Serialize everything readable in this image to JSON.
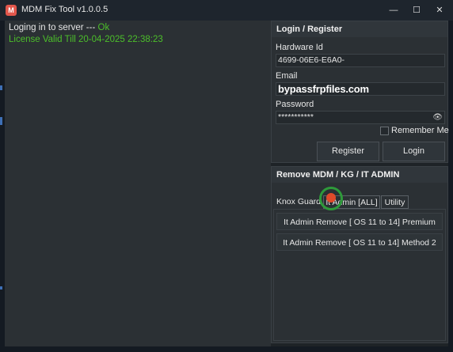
{
  "window": {
    "title": "MDM Fix Tool v1.0.0.5",
    "app_icon_letter": "M",
    "controls": {
      "minimize": "—",
      "maximize": "☐",
      "close": "✕"
    }
  },
  "log": {
    "line1_text": "Loging in to server --- ",
    "line1_status": "Ok",
    "line2": "License Valid Till 20-04-2025 22:38:23"
  },
  "login_panel": {
    "title": "Login / Register",
    "hardware_label": "Hardware Id",
    "hardware_value": "4699-06E6-E6A0-",
    "email_label": "Email",
    "email_value": "bypassfrpfiles.com",
    "password_label": "Password",
    "password_value": "***********",
    "eye_icon": "👁",
    "remember_label": "Remember Me",
    "register_label": "Register",
    "login_label": "Login"
  },
  "remove_panel": {
    "title": "Remove MDM / KG / IT ADMIN",
    "tabs": [
      "Knox Guard",
      "It Admin [ALL]",
      "Utility"
    ],
    "actions": [
      "It Admin Remove [ OS 11 to 14] Premium",
      "It Admin Remove [ OS 11 to 14] Method 2"
    ]
  },
  "colors": {
    "status_ok": "#4cbf2a",
    "cursor_ring": "#2e9a3a",
    "cursor_dot": "#e04a2a"
  }
}
